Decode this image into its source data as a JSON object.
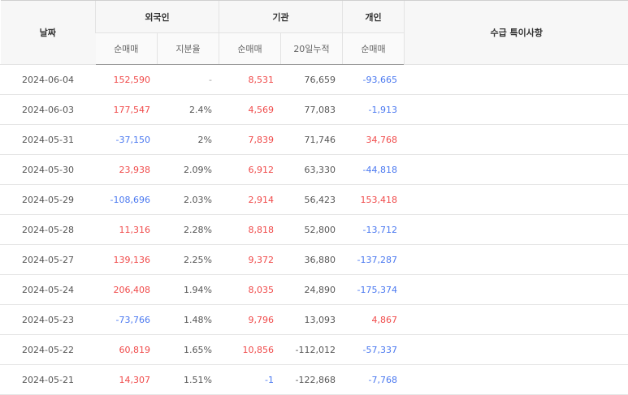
{
  "table": {
    "headers": {
      "date": "날짜",
      "foreign": "외국인",
      "institution": "기관",
      "individual": "개인",
      "note": "수급 특이사항",
      "foreign_net": "순매매",
      "foreign_ratio": "지분율",
      "inst_net": "순매매",
      "inst_20d": "20일누적",
      "indiv_net": "순매매"
    },
    "rows": [
      {
        "date": "2024-06-04",
        "foreign_net": "152,590",
        "foreign_ratio": "-",
        "inst_net": "8,531",
        "inst_20d": "76,659",
        "indiv_net": "-93,665",
        "note": ""
      },
      {
        "date": "2024-06-03",
        "foreign_net": "177,547",
        "foreign_ratio": "2.4%",
        "inst_net": "4,569",
        "inst_20d": "77,083",
        "indiv_net": "-1,913",
        "note": ""
      },
      {
        "date": "2024-05-31",
        "foreign_net": "-37,150",
        "foreign_ratio": "2%",
        "inst_net": "7,839",
        "inst_20d": "71,746",
        "indiv_net": "34,768",
        "note": ""
      },
      {
        "date": "2024-05-30",
        "foreign_net": "23,938",
        "foreign_ratio": "2.09%",
        "inst_net": "6,912",
        "inst_20d": "63,330",
        "indiv_net": "-44,818",
        "note": ""
      },
      {
        "date": "2024-05-29",
        "foreign_net": "-108,696",
        "foreign_ratio": "2.03%",
        "inst_net": "2,914",
        "inst_20d": "56,423",
        "indiv_net": "153,418",
        "note": ""
      },
      {
        "date": "2024-05-28",
        "foreign_net": "11,316",
        "foreign_ratio": "2.28%",
        "inst_net": "8,818",
        "inst_20d": "52,800",
        "indiv_net": "-13,712",
        "note": ""
      },
      {
        "date": "2024-05-27",
        "foreign_net": "139,136",
        "foreign_ratio": "2.25%",
        "inst_net": "9,372",
        "inst_20d": "36,880",
        "indiv_net": "-137,287",
        "note": ""
      },
      {
        "date": "2024-05-24",
        "foreign_net": "206,408",
        "foreign_ratio": "1.94%",
        "inst_net": "8,035",
        "inst_20d": "24,890",
        "indiv_net": "-175,374",
        "note": ""
      },
      {
        "date": "2024-05-23",
        "foreign_net": "-73,766",
        "foreign_ratio": "1.48%",
        "inst_net": "9,796",
        "inst_20d": "13,093",
        "indiv_net": "4,867",
        "note": ""
      },
      {
        "date": "2024-05-22",
        "foreign_net": "60,819",
        "foreign_ratio": "1.65%",
        "inst_net": "10,856",
        "inst_20d": "-112,012",
        "indiv_net": "-57,337",
        "note": ""
      },
      {
        "date": "2024-05-21",
        "foreign_net": "14,307",
        "foreign_ratio": "1.51%",
        "inst_net": "-1",
        "inst_20d": "-122,868",
        "indiv_net": "-7,768",
        "note": ""
      }
    ]
  }
}
